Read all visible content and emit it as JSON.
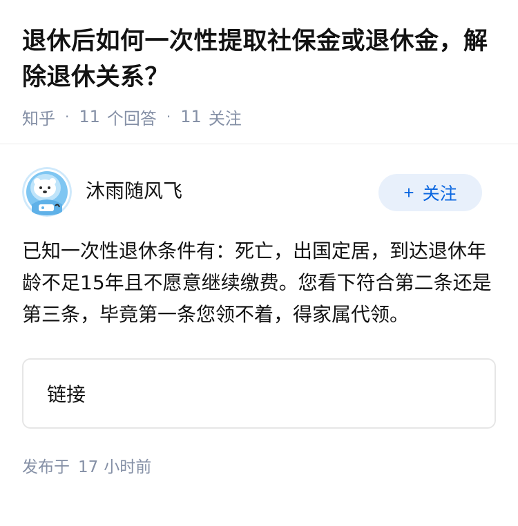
{
  "question": {
    "title": "退休后如何一次性提取社保金或退休金，解除退休关系？",
    "source": "知乎",
    "answer_count": "11",
    "answer_label": "个回答",
    "follow_count": "11",
    "follow_label": "关注"
  },
  "answer": {
    "author_name": "沐雨随风飞",
    "avatar_icon": "polar-bear-astronaut-avatar",
    "follow_button": {
      "plus": "+",
      "label": "关注"
    },
    "content": "已知一次性退休条件有：死亡，出国定居，到达退休年龄不足15年且不愿意继续缴费。您看下符合第二条还是第三条，毕竟第一条您领不着，得家属代领。",
    "link_card_label": "链接",
    "published_prefix": "发布于",
    "published_value": "17",
    "published_suffix": "小时前"
  },
  "colors": {
    "title": "#121212",
    "meta": "#8590a6",
    "follow_bg": "#e8f0fb",
    "follow_text": "#0a66e0"
  }
}
